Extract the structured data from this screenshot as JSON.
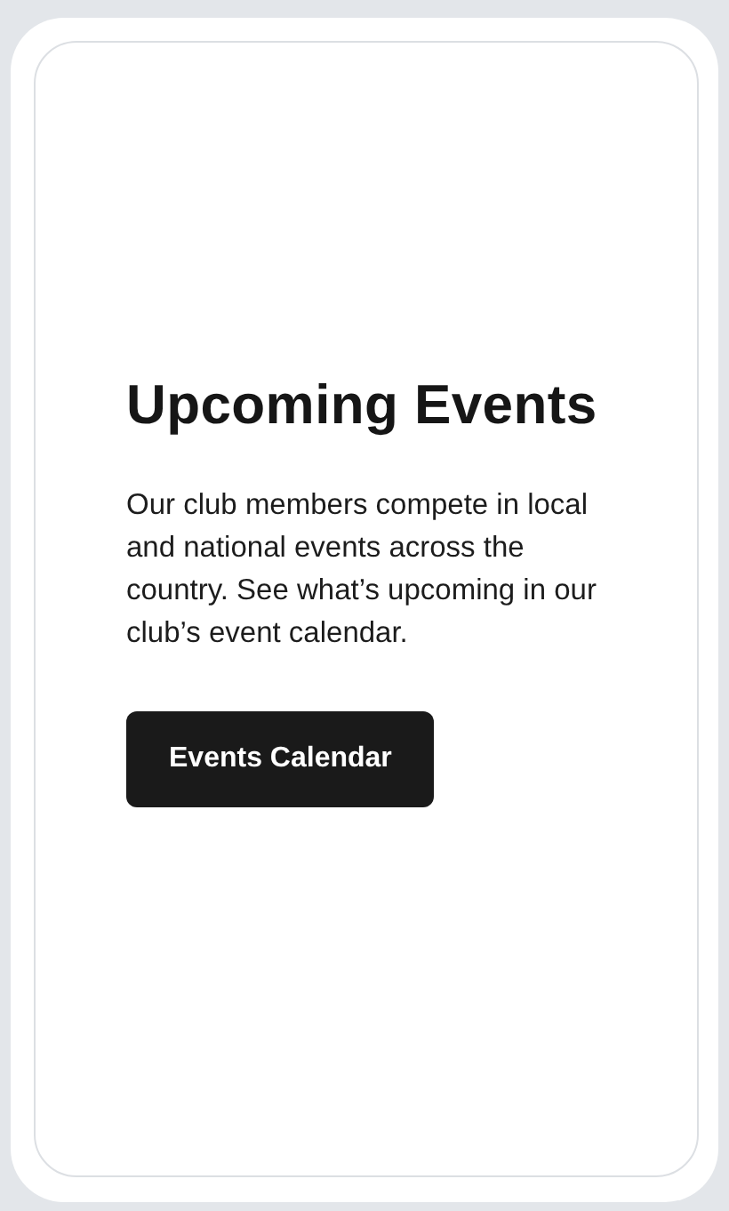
{
  "heading": "Upcoming Events",
  "description": "Our club members compete in local and national events across the country. See what’s upcoming in our club’s event calendar.",
  "button": {
    "label": "Events Calendar"
  }
}
